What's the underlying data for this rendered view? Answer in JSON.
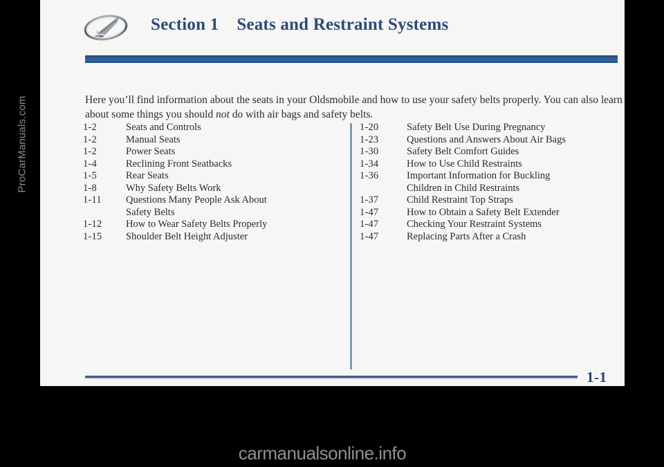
{
  "document": {
    "sheet_background": "#f6f6f5",
    "canvas_background": "#000000"
  },
  "header": {
    "logo_name": "oldsmobile-rocket-logo",
    "section_label": "Section 1",
    "section_title": "Seats and Restraint Systems",
    "heading_color": "#2e4a78",
    "rule_color": "#2f5f9b"
  },
  "intro": {
    "text_part_1": "Here you’ll find information about the seats in your Oldsmobile and how to use your safety belts properly. You can also learn about some things you should ",
    "emphasis": "not",
    "text_part_2": " do with air bags and safety belts."
  },
  "toc": {
    "left_column": [
      {
        "page": "1-2",
        "title": "Seats and Controls"
      },
      {
        "page": "1-2",
        "title": "Manual Seats"
      },
      {
        "page": "1-2",
        "title": "Power Seats"
      },
      {
        "page": "1-4",
        "title": "Reclining Front Seatbacks"
      },
      {
        "page": "1-5",
        "title": "Rear Seats"
      },
      {
        "page": "1-8",
        "title": "Why Safety Belts Work"
      },
      {
        "page": "1-11",
        "title": "Questions Many People Ask About"
      },
      {
        "page": "",
        "title": "Safety Belts",
        "continuation": true
      },
      {
        "page": "1-12",
        "title": "How to Wear Safety Belts Properly"
      },
      {
        "page": "1-15",
        "title": "Shoulder Belt Height Adjuster"
      }
    ],
    "right_column": [
      {
        "page": "1-20",
        "title": "Safety Belt Use During Pregnancy"
      },
      {
        "page": "1-23",
        "title": "Questions and Answers About Air Bags"
      },
      {
        "page": "1-30",
        "title": "Safety Belt Comfort Guides"
      },
      {
        "page": "1-34",
        "title": "How to Use Child Restraints"
      },
      {
        "page": "1-36",
        "title": "Important Information for Buckling"
      },
      {
        "page": "",
        "title": "Children in Child Restraints",
        "continuation": true
      },
      {
        "page": "1-37",
        "title": "Child Restraint Top Straps"
      },
      {
        "page": "1-47",
        "title": "How to Obtain a Safety Belt Extender"
      },
      {
        "page": "1-47",
        "title": "Checking Your Restraint Systems"
      },
      {
        "page": "1-47",
        "title": "Replacing Parts After a Crash"
      }
    ]
  },
  "footer": {
    "page_number": "1-1",
    "page_number_color": "#23406e"
  },
  "watermarks": {
    "side": "ProCarManuals.com",
    "bottom": "carmanualsonline.info"
  }
}
